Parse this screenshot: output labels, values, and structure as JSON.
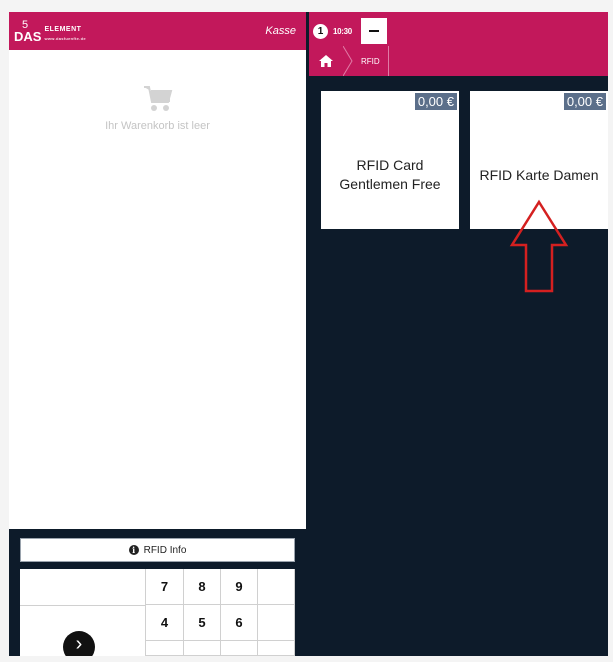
{
  "left": {
    "logo": {
      "mark": "DAS",
      "five": "5",
      "word": "ELEMENT",
      "sub": "www.dasfuenfte.de"
    },
    "header_title": "Kasse",
    "empty_cart_text": "Ihr Warenkorb ist leer",
    "rfid_info_label": "RFID Info",
    "numpad": [
      "7",
      "8",
      "9",
      "",
      "4",
      "5",
      "6",
      "",
      "",
      "",
      "",
      ""
    ]
  },
  "right": {
    "order_count": "1",
    "time": "10:30",
    "breadcrumb": {
      "current": "RFID"
    },
    "products": [
      {
        "price": "0,00 €",
        "name": "RFID Card Gentlemen Free"
      },
      {
        "price": "0,00 €",
        "name": "RFID Karte Damen"
      }
    ]
  },
  "colors": {
    "brand": "#c2185b",
    "dark_bg": "#0d1b2a",
    "price_badge": "#5b6f8a",
    "annotation_arrow": "#d42020"
  }
}
